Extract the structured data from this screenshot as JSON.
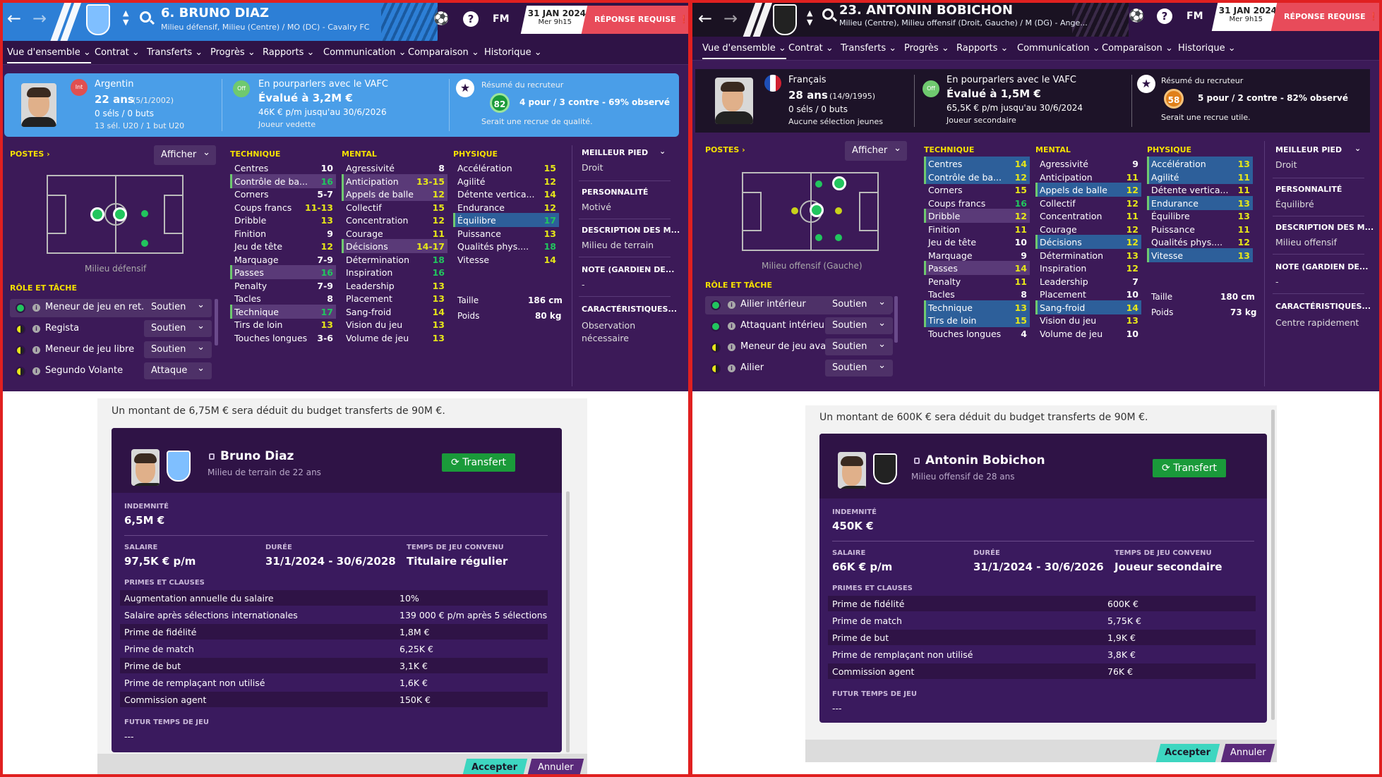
{
  "left": {
    "header": {
      "number_name": "6. BRUNO DIAZ",
      "positions_club": "Milieu défensif, Milieu (Centre) / MO (DC) - Cavalry FC",
      "date": "31 JAN 2024",
      "time": "Mer 9h15",
      "fm": "FM",
      "response": "RÉPONSE REQUISE"
    },
    "tabs": [
      "Vue d'ensemble",
      "Contrat",
      "Transferts",
      "Progrès",
      "Rapports",
      "Communication",
      "Comparaison",
      "Historique"
    ],
    "info": {
      "nationality": "Argentin",
      "flag_label": "Int",
      "age": "22 ans",
      "dob": "(5/1/2002)",
      "caps": "0 séls / 0 buts",
      "youth": "13 sél. U20 / 1 but U20",
      "status_badge": "Off",
      "status": "En pourparlers avec le VAFC",
      "value": "Évalué à 3,2M €",
      "contract": "46K € p/m jusqu'au 30/6/2026",
      "role_status": "Joueur vedette",
      "scout_title": "Résumé du recruteur",
      "scout_score": "82",
      "scout_summary": "4 pour / 3 contre - 69% observé",
      "scout_verdict": "Serait une recrue de qualité."
    },
    "positions": {
      "title": "POSTES",
      "show": "Afficher",
      "label": "Milieu défensif"
    },
    "roles": {
      "title": "RÔLE ET TÂCHE",
      "items": [
        {
          "name": "Meneur de jeu en ret...",
          "duty": "Soutien"
        },
        {
          "name": "Regista",
          "duty": "Soutien"
        },
        {
          "name": "Meneur de jeu libre",
          "duty": "Soutien"
        },
        {
          "name": "Segundo Volante",
          "duty": "Attaque"
        }
      ]
    },
    "technique": {
      "title": "TECHNIQUE",
      "items": [
        {
          "n": "Centres",
          "v": "10"
        },
        {
          "n": "Contrôle de ba...",
          "v": "16"
        },
        {
          "n": "Corners",
          "v": "5-7"
        },
        {
          "n": "Coups francs",
          "v": "11-13"
        },
        {
          "n": "Dribble",
          "v": "13"
        },
        {
          "n": "Finition",
          "v": "9"
        },
        {
          "n": "Jeu de tête",
          "v": "12"
        },
        {
          "n": "Marquage",
          "v": "7-9"
        },
        {
          "n": "Passes",
          "v": "16"
        },
        {
          "n": "Penalty",
          "v": "7-9"
        },
        {
          "n": "Tacles",
          "v": "8"
        },
        {
          "n": "Technique",
          "v": "17"
        },
        {
          "n": "Tirs de loin",
          "v": "13"
        },
        {
          "n": "Touches longues",
          "v": "3-6"
        }
      ]
    },
    "mental": {
      "title": "MENTAL",
      "items": [
        {
          "n": "Agressivité",
          "v": "8"
        },
        {
          "n": "Anticipation",
          "v": "13-15"
        },
        {
          "n": "Appels de balle",
          "v": "12"
        },
        {
          "n": "Collectif",
          "v": "15"
        },
        {
          "n": "Concentration",
          "v": "12"
        },
        {
          "n": "Courage",
          "v": "11"
        },
        {
          "n": "Décisions",
          "v": "14-17"
        },
        {
          "n": "Détermination",
          "v": "18"
        },
        {
          "n": "Inspiration",
          "v": "16"
        },
        {
          "n": "Leadership",
          "v": "13"
        },
        {
          "n": "Placement",
          "v": "13"
        },
        {
          "n": "Sang-froid",
          "v": "14"
        },
        {
          "n": "Vision du jeu",
          "v": "13"
        },
        {
          "n": "Volume de jeu",
          "v": "13"
        }
      ]
    },
    "physique": {
      "title": "PHYSIQUE",
      "items": [
        {
          "n": "Accélération",
          "v": "15"
        },
        {
          "n": "Agilité",
          "v": "12"
        },
        {
          "n": "Détente vertica...",
          "v": "14"
        },
        {
          "n": "Endurance",
          "v": "12"
        },
        {
          "n": "Équilibre",
          "v": "17"
        },
        {
          "n": "Puissance",
          "v": "13"
        },
        {
          "n": "Qualités phys....",
          "v": "18"
        },
        {
          "n": "Vitesse",
          "v": "14"
        }
      ],
      "height_label": "Taille",
      "height": "186 cm",
      "weight_label": "Poids",
      "weight": "80 kg"
    },
    "right": {
      "foot_h": "MEILLEUR PIED",
      "foot": "Droit",
      "pers_h": "PERSONNALITÉ",
      "pers": "Motivé",
      "desc_h": "DESCRIPTION DES M...",
      "desc": "Milieu de terrain",
      "gk_h": "NOTE (GARDIEN DE...",
      "gk": "-",
      "car_h": "CARACTÉRISTIQUES...",
      "car1": "Observation",
      "car2": "nécessaire"
    },
    "offer": {
      "note": "Un montant de 6,75M € sera déduit du budget transferts de 90M €.",
      "name": "Bruno Diaz",
      "sub": "Milieu de terrain de 22 ans",
      "transfer_btn": "Transfert",
      "fee_label": "INDEMNITÉ",
      "fee": "6,5M €",
      "salary_label": "SALAIRE",
      "salary": "97,5K € p/m",
      "duration_label": "DURÉE",
      "duration": "31/1/2024 - 30/6/2028",
      "playtime_label": "TEMPS DE JEU CONVENU",
      "playtime": "Titulaire régulier",
      "clauses_label": "PRIMES ET CLAUSES",
      "clauses": [
        {
          "k": "Augmentation annuelle du salaire",
          "v": "10%"
        },
        {
          "k": "Salaire après sélections internationales",
          "v": "139 000 € p/m après 5 sélections"
        },
        {
          "k": "Prime de fidélité",
          "v": "1,8M €"
        },
        {
          "k": "Prime de match",
          "v": "6,25K €"
        },
        {
          "k": "Prime de but",
          "v": "3,1K €"
        },
        {
          "k": "Prime de remplaçant non utilisé",
          "v": "1,6K €"
        },
        {
          "k": "Commission agent",
          "v": "150K €"
        }
      ],
      "future_label": "FUTUR TEMPS DE JEU",
      "future": "---",
      "accept": "Accepter",
      "cancel": "Annuler"
    }
  },
  "right": {
    "header": {
      "number_name": "23. ANTONIN BOBICHON",
      "positions_club": "Milieu (Centre), Milieu offensif (Droit, Gauche) / M (DG) - Ange...",
      "date": "31 JAN 2024",
      "time": "Mer 9h15",
      "fm": "FM",
      "response": "RÉPONSE REQUISE"
    },
    "tabs": [
      "Vue d'ensemble",
      "Contrat",
      "Transferts",
      "Progrès",
      "Rapports",
      "Communication",
      "Comparaison",
      "Historique"
    ],
    "info": {
      "nationality": "Français",
      "age": "28 ans",
      "dob": "(14/9/1995)",
      "caps": "0 séls / 0 buts",
      "youth": "Aucune sélection jeunes",
      "status_badge": "Off",
      "status": "En pourparlers avec le VAFC",
      "value": "Évalué à 1,5M €",
      "contract": "65,5K € p/m jusqu'au 30/6/2024",
      "role_status": "Joueur secondaire",
      "scout_title": "Résumé du recruteur",
      "scout_score": "58",
      "scout_summary": "5 pour / 2 contre - 82% observé",
      "scout_verdict": "Serait une recrue utile."
    },
    "positions": {
      "title": "POSTES",
      "show": "Afficher",
      "label": "Milieu offensif (Gauche)"
    },
    "roles": {
      "title": "RÔLE ET TÂCHE",
      "items": [
        {
          "name": "Ailier intérieur",
          "duty": "Soutien"
        },
        {
          "name": "Attaquant intérieur",
          "duty": "Soutien"
        },
        {
          "name": "Meneur de jeu avancé",
          "duty": "Soutien"
        },
        {
          "name": "Ailier",
          "duty": "Soutien"
        }
      ]
    },
    "technique": {
      "title": "TECHNIQUE",
      "items": [
        {
          "n": "Centres",
          "v": "14"
        },
        {
          "n": "Contrôle de ba...",
          "v": "12"
        },
        {
          "n": "Corners",
          "v": "15"
        },
        {
          "n": "Coups francs",
          "v": "16"
        },
        {
          "n": "Dribble",
          "v": "12"
        },
        {
          "n": "Finition",
          "v": "11"
        },
        {
          "n": "Jeu de tête",
          "v": "10"
        },
        {
          "n": "Marquage",
          "v": "9"
        },
        {
          "n": "Passes",
          "v": "14"
        },
        {
          "n": "Penalty",
          "v": "11"
        },
        {
          "n": "Tacles",
          "v": "8"
        },
        {
          "n": "Technique",
          "v": "13"
        },
        {
          "n": "Tirs de loin",
          "v": "15"
        },
        {
          "n": "Touches longues",
          "v": "4"
        }
      ]
    },
    "mental": {
      "title": "MENTAL",
      "items": [
        {
          "n": "Agressivité",
          "v": "9"
        },
        {
          "n": "Anticipation",
          "v": "11"
        },
        {
          "n": "Appels de balle",
          "v": "12"
        },
        {
          "n": "Collectif",
          "v": "12"
        },
        {
          "n": "Concentration",
          "v": "11"
        },
        {
          "n": "Courage",
          "v": "12"
        },
        {
          "n": "Décisions",
          "v": "12"
        },
        {
          "n": "Détermination",
          "v": "13"
        },
        {
          "n": "Inspiration",
          "v": "12"
        },
        {
          "n": "Leadership",
          "v": "7"
        },
        {
          "n": "Placement",
          "v": "10"
        },
        {
          "n": "Sang-froid",
          "v": "14"
        },
        {
          "n": "Vision du jeu",
          "v": "13"
        },
        {
          "n": "Volume de jeu",
          "v": "10"
        }
      ]
    },
    "physique": {
      "title": "PHYSIQUE",
      "items": [
        {
          "n": "Accélération",
          "v": "13"
        },
        {
          "n": "Agilité",
          "v": "11"
        },
        {
          "n": "Détente vertica...",
          "v": "11"
        },
        {
          "n": "Endurance",
          "v": "13"
        },
        {
          "n": "Équilibre",
          "v": "13"
        },
        {
          "n": "Puissance",
          "v": "11"
        },
        {
          "n": "Qualités phys....",
          "v": "12"
        },
        {
          "n": "Vitesse",
          "v": "13"
        }
      ],
      "height_label": "Taille",
      "height": "180 cm",
      "weight_label": "Poids",
      "weight": "73 kg"
    },
    "right": {
      "foot_h": "MEILLEUR PIED",
      "foot": "Droit",
      "pers_h": "PERSONNALITÉ",
      "pers": "Équilibré",
      "desc_h": "DESCRIPTION DES M...",
      "desc": "Milieu offensif",
      "gk_h": "NOTE (GARDIEN DE...",
      "gk": "-",
      "car_h": "CARACTÉRISTIQUES...",
      "car1": "Centre rapidement",
      "car2": ""
    },
    "offer": {
      "note": "Un montant de 600K € sera déduit du budget transferts de 90M €.",
      "name": "Antonin Bobichon",
      "sub": "Milieu offensif de 28 ans",
      "transfer_btn": "Transfert",
      "fee_label": "INDEMNITÉ",
      "fee": "450K €",
      "salary_label": "SALAIRE",
      "salary": "66K € p/m",
      "duration_label": "DURÉE",
      "duration": "31/1/2024 - 30/6/2026",
      "playtime_label": "TEMPS DE JEU CONVENU",
      "playtime": "Joueur secondaire",
      "clauses_label": "PRIMES ET CLAUSES",
      "clauses": [
        {
          "k": "Prime de fidélité",
          "v": "600K €"
        },
        {
          "k": "Prime de match",
          "v": "5,75K €"
        },
        {
          "k": "Prime de but",
          "v": "1,9K €"
        },
        {
          "k": "Prime de remplaçant non utilisé",
          "v": "3,8K €"
        },
        {
          "k": "Commission agent",
          "v": "76K €"
        }
      ],
      "future_label": "FUTUR TEMPS DE JEU",
      "future": "---",
      "accept": "Accepter",
      "cancel": "Annuler"
    }
  },
  "colors": {
    "accent_blue": "#2d7fd6",
    "panel_purple": "#3c1a58",
    "header_purple": "#2f1346",
    "alert_red": "#e84b5a",
    "green_button": "#1a9a3a",
    "accept_teal": "#3dd6c0",
    "divider_red": "#e02020"
  },
  "icons": [
    "back-arrow-icon",
    "forward-arrow-icon",
    "club-crest-icon",
    "search-icon",
    "football-icon",
    "help-icon",
    "star-icon",
    "lock-icon",
    "refresh-icon",
    "chevron-down-icon",
    "info-icon"
  ]
}
